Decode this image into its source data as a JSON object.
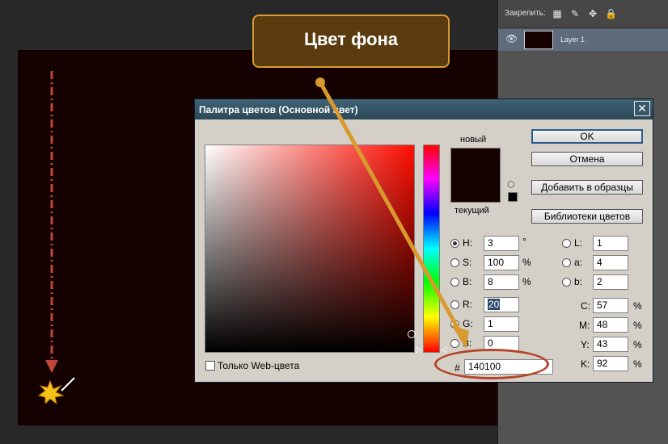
{
  "layers_panel": {
    "lock_label": "Закрепить:",
    "lock_icons": [
      "checker-icon",
      "brush-icon",
      "move-icon",
      "lock-icon"
    ],
    "layer": {
      "name": "Layer 1",
      "visibility_icon": "eye-icon"
    }
  },
  "dialog": {
    "title": "Палитра цветов (Основной цвет)",
    "close": "✕",
    "new_label": "новый",
    "current_label": "текущий",
    "buttons": {
      "ok": "OK",
      "cancel": "Отмена",
      "add_swatches": "Добавить в образцы",
      "libraries": "Библиотеки цветов"
    },
    "hsb": [
      {
        "label": "H:",
        "value": "3",
        "unit": "°",
        "selected": true
      },
      {
        "label": "S:",
        "value": "100",
        "unit": "%",
        "selected": false
      },
      {
        "label": "B:",
        "value": "8",
        "unit": "%",
        "selected": false
      }
    ],
    "rgb": [
      {
        "label": "R:",
        "value": "20"
      },
      {
        "label": "G:",
        "value": "1"
      },
      {
        "label": "B:",
        "value": "0"
      }
    ],
    "lab": [
      {
        "label": "L:",
        "value": "1"
      },
      {
        "label": "a:",
        "value": "4"
      },
      {
        "label": "b:",
        "value": "2"
      }
    ],
    "cmyk": [
      {
        "label": "C:",
        "value": "57",
        "unit": "%"
      },
      {
        "label": "M:",
        "value": "48",
        "unit": "%"
      },
      {
        "label": "Y:",
        "value": "43",
        "unit": "%"
      },
      {
        "label": "K:",
        "value": "92",
        "unit": "%"
      }
    ],
    "hash": "#",
    "hex": "140100",
    "websafe_label": "Только Web-цвета",
    "color_hex": "#140100"
  },
  "callout": {
    "text": "Цвет фона"
  },
  "colors": {
    "accent": "#d89a2e",
    "highlight_ellipse": "#b5452a",
    "guide_line": "#c0453a"
  }
}
